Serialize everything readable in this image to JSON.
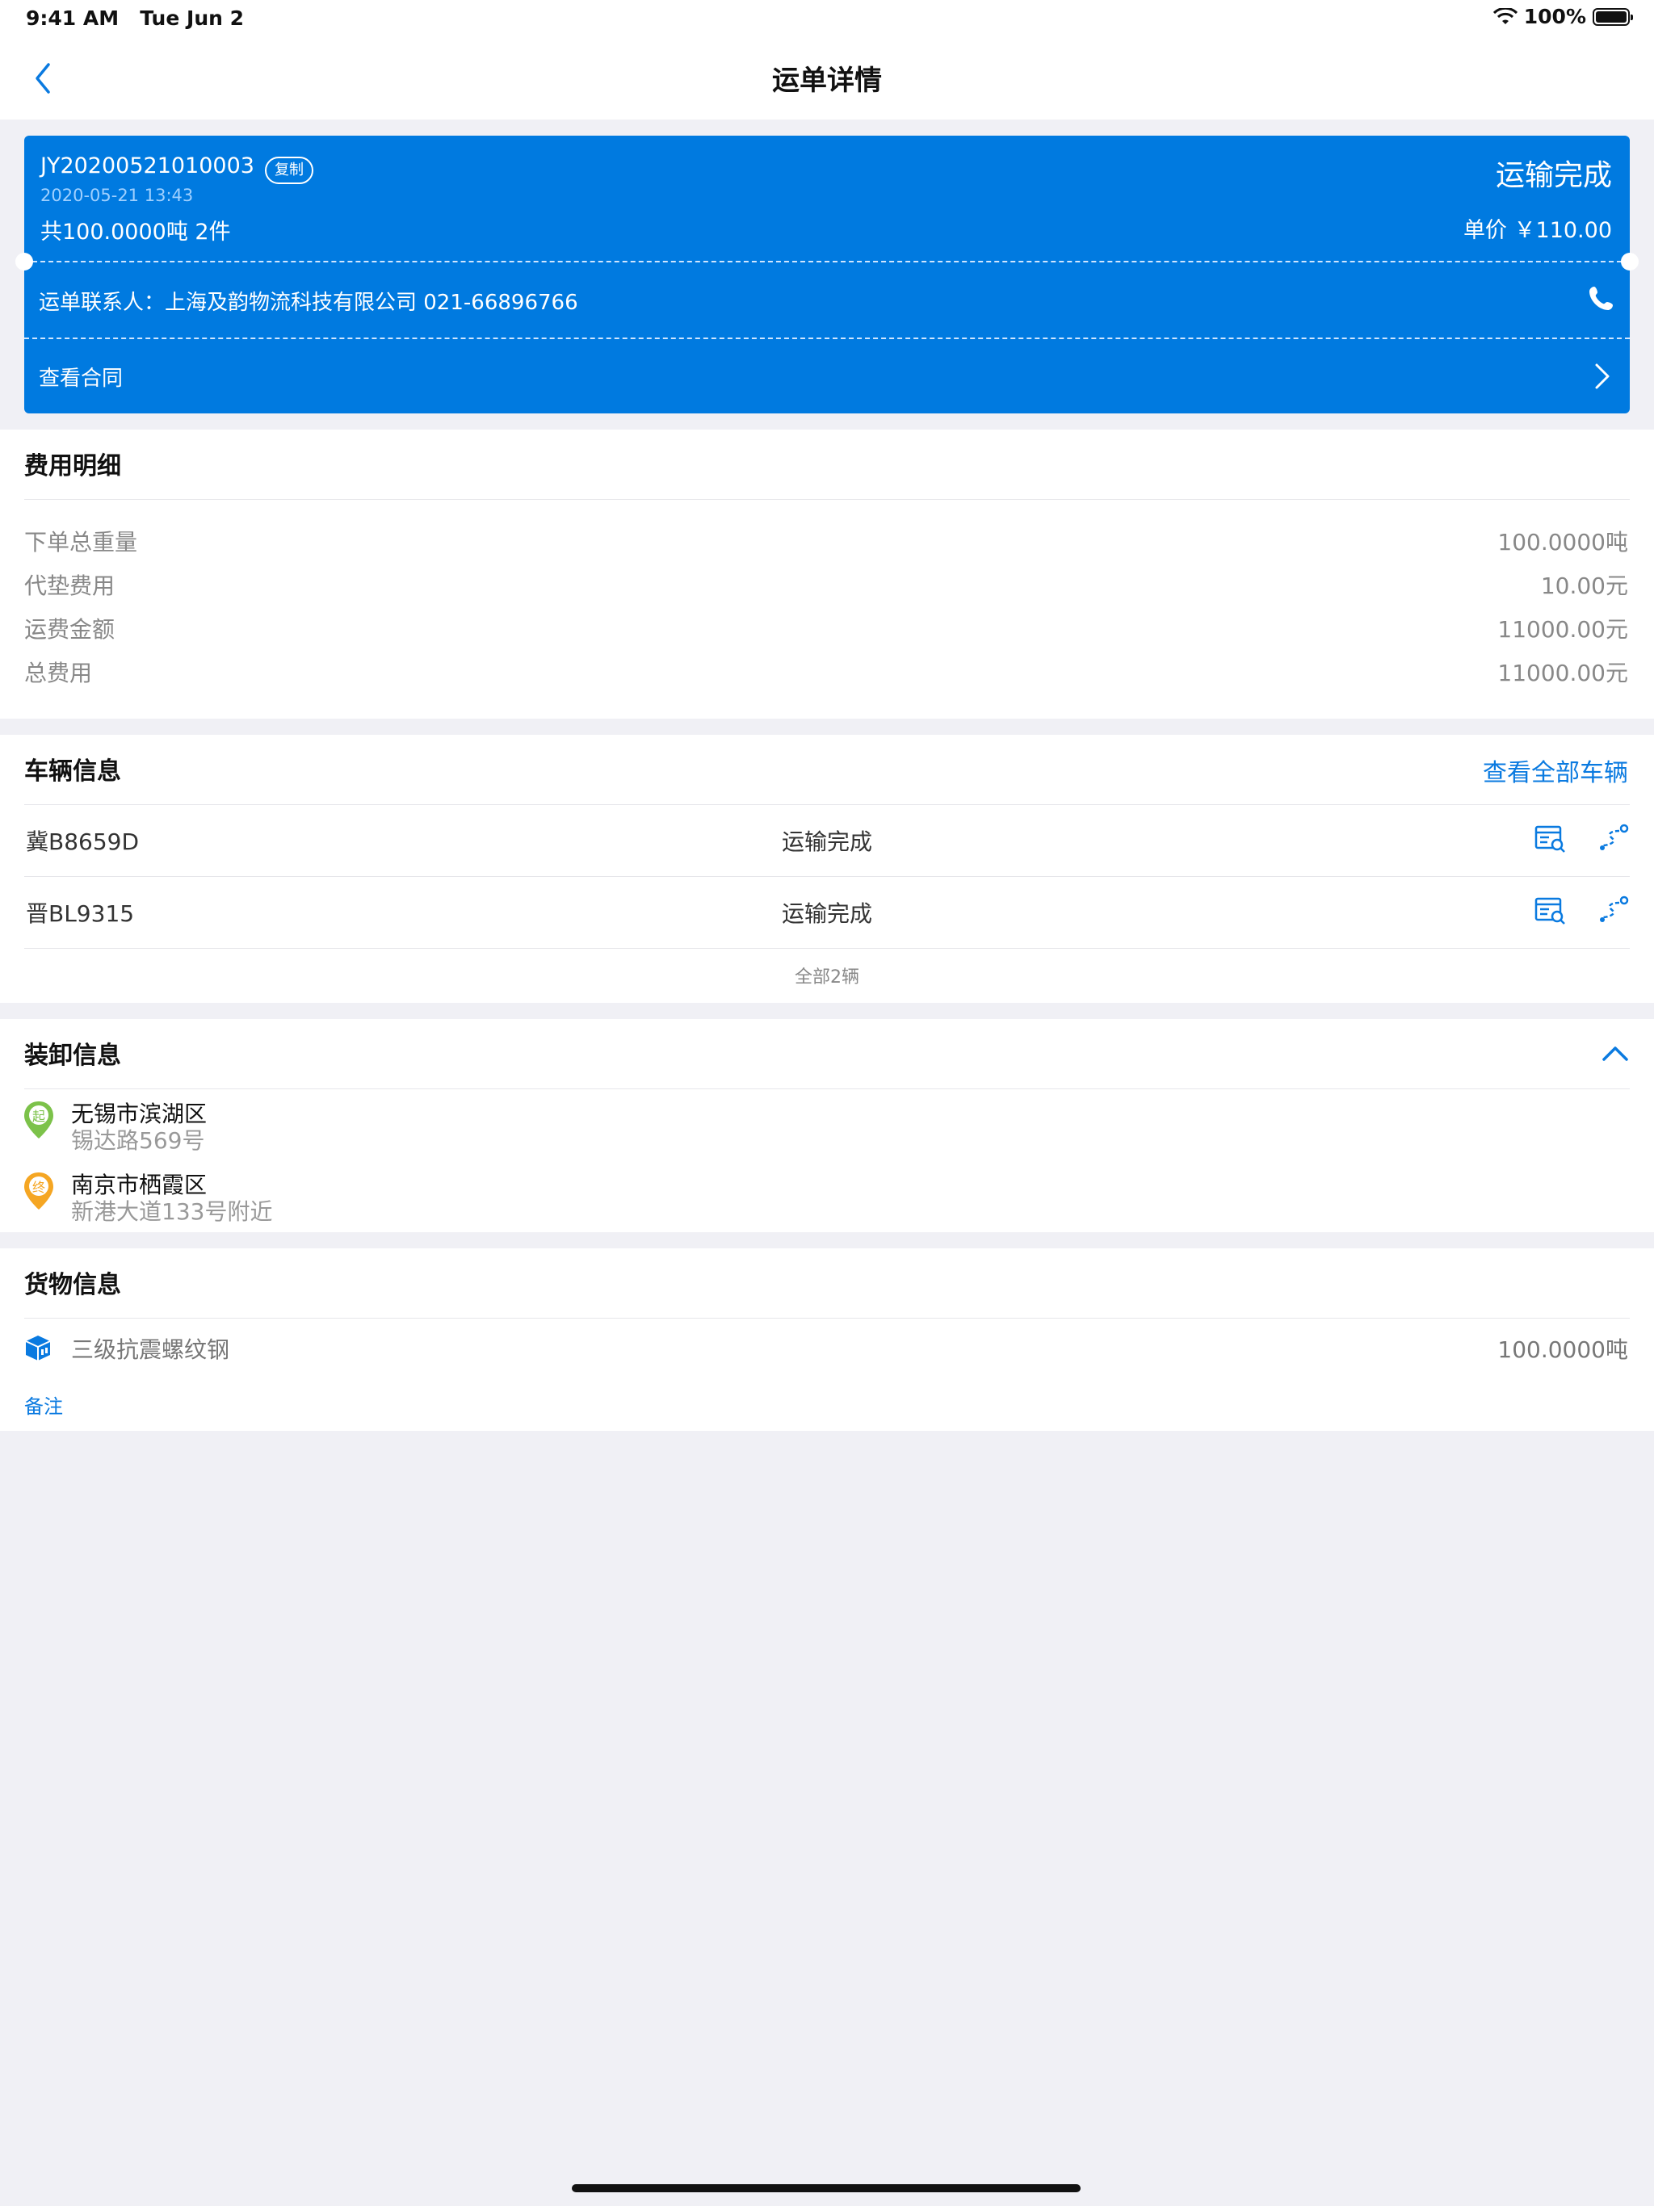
{
  "status_bar": {
    "time": "9:41 AM",
    "date": "Tue Jun 2",
    "battery": "100%"
  },
  "nav": {
    "title": "运单详情"
  },
  "order": {
    "number": "JY20200521010003",
    "copy_label": "复制",
    "datetime": "2020-05-21 13:43",
    "total": "共100.0000吨  2件",
    "status": "运输完成",
    "unit_price": "单价 ￥110.00",
    "contact": "运单联系人：上海及韵物流科技有限公司 021-66896766",
    "contract_label": "查看合同"
  },
  "fees": {
    "title": "费用明细",
    "rows": [
      {
        "label": "下单总重量",
        "value": "100.0000吨"
      },
      {
        "label": "代垫费用",
        "value": "10.00元"
      },
      {
        "label": "运费金额",
        "value": "11000.00元"
      },
      {
        "label": "总费用",
        "value": "11000.00元"
      }
    ]
  },
  "vehicles": {
    "title": "车辆信息",
    "view_all": "查看全部车辆",
    "rows": [
      {
        "plate": "冀B8659D",
        "status": "运输完成"
      },
      {
        "plate": "晋BL9315",
        "status": "运输完成"
      }
    ],
    "total": "全部2辆"
  },
  "loading": {
    "title": "装卸信息",
    "start_badge": "起",
    "end_badge": "终",
    "start": {
      "area": "无锡市滨湖区",
      "street": "锡达路569号"
    },
    "end": {
      "area": "南京市栖霞区",
      "street": "新港大道133号附近"
    }
  },
  "cargo": {
    "title": "货物信息",
    "name": "三级抗震螺纹钢",
    "weight": "100.0000吨",
    "remark_label": "备注"
  },
  "colors": {
    "accent": "#007ae0",
    "start_pin": "#7cc24a",
    "end_pin": "#f5a623"
  }
}
